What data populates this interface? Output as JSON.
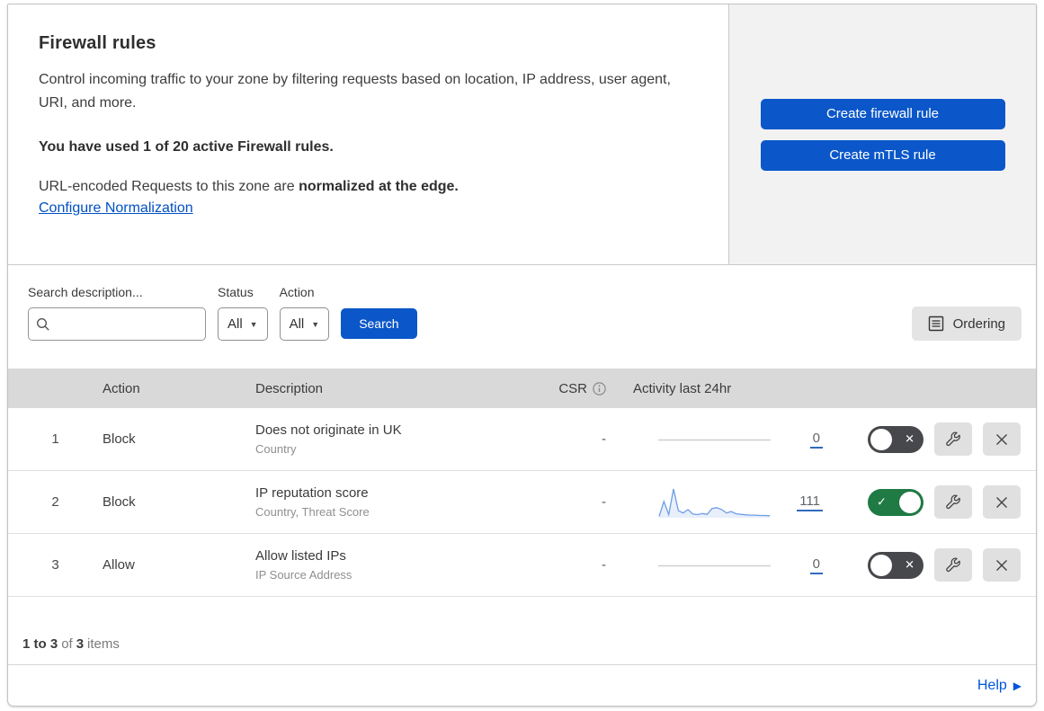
{
  "header": {
    "title": "Firewall rules",
    "description": "Control incoming traffic to your zone by filtering requests based on location, IP address, user agent, URI, and more.",
    "usage_note": "You have used 1 of 20 active Firewall rules.",
    "normalization_prefix": "URL-encoded Requests to this zone are ",
    "normalization_bold": "normalized at the edge.",
    "normalization_link": "Configure Normalization",
    "create_firewall_button": "Create firewall rule",
    "create_mtls_button": "Create mTLS rule"
  },
  "filters": {
    "search_label": "Search description...",
    "status_label": "Status",
    "status_value": "All",
    "action_label": "Action",
    "action_value": "All",
    "search_button": "Search",
    "ordering_button": "Ordering"
  },
  "table": {
    "columns": {
      "action": "Action",
      "description": "Description",
      "csr": "CSR",
      "activity": "Activity last 24hr"
    },
    "rows": [
      {
        "priority": "1",
        "action": "Block",
        "title": "Does not originate in UK",
        "fields": "Country",
        "csr": "-",
        "count": "0",
        "enabled": false
      },
      {
        "priority": "2",
        "action": "Block",
        "title": "IP reputation score",
        "fields": "Country, Threat Score",
        "csr": "-",
        "count": "111",
        "enabled": true,
        "sparkline": [
          2,
          55,
          8,
          100,
          22,
          14,
          26,
          10,
          8,
          12,
          9,
          30,
          33,
          26,
          14,
          19,
          11,
          9,
          7,
          6,
          6,
          5,
          5,
          4
        ]
      },
      {
        "priority": "3",
        "action": "Allow",
        "title": "Allow listed IPs",
        "fields": "IP Source Address",
        "csr": "-",
        "count": "0",
        "enabled": false
      }
    ]
  },
  "footer": {
    "range": "1 to 3",
    "of": "of",
    "total": "3",
    "items": "items",
    "help": "Help"
  },
  "colors": {
    "primary_blue": "#0b57c9",
    "link_blue": "#0051c3",
    "help_blue": "#0055dc",
    "toggle_on_green": "#1f7a44",
    "toggle_off_gray": "#47484c",
    "header_row_gray": "#d9d9d9",
    "panel_gray": "#f2f2f2",
    "sparkline": "#6d9ee8",
    "sparkline_fill": "rgba(109,158,232,0.16)",
    "flatline": "#cfcfcf",
    "count_underline": "#2f6bbf"
  }
}
